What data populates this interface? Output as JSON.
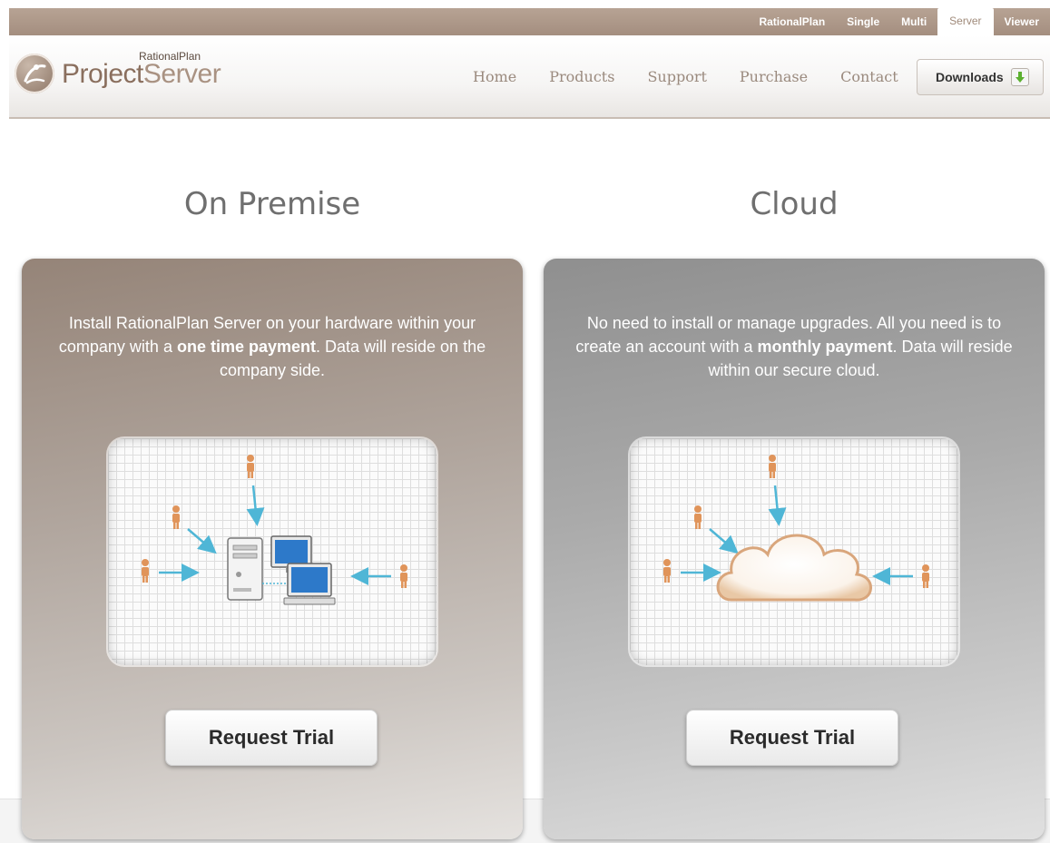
{
  "topbar": {
    "links": [
      {
        "label": "RationalPlan",
        "active": false
      },
      {
        "label": "Single",
        "active": false
      },
      {
        "label": "Multi",
        "active": false
      },
      {
        "label": "Server",
        "active": true
      },
      {
        "label": "Viewer",
        "active": false
      }
    ]
  },
  "header": {
    "logo_small": "RationalPlan",
    "logo_part1": "Project",
    "logo_part2": "Server",
    "nav": [
      "Home",
      "Products",
      "Support",
      "Purchase",
      "Contact"
    ],
    "downloads_label": "Downloads"
  },
  "on_premise": {
    "title": "On Premise",
    "desc_pre": "Install RationalPlan Server on your hardware within your company with a ",
    "desc_bold": "one time payment",
    "desc_post": ". Data will reside on the company side.",
    "button": "Request Trial"
  },
  "cloud": {
    "title": "Cloud",
    "desc_pre": "No need to install or manage upgrades. All you need is to create an account with a ",
    "desc_bold": "monthly payment",
    "desc_post": ". Data will reside within our secure cloud.",
    "button": "Request Trial"
  },
  "colors": {
    "brand_brown": "#a48e7f",
    "panel_left": "#958478",
    "panel_right": "#8f8f8f",
    "arrow_blue": "#4fb6d6",
    "person_orange": "#e0945a"
  }
}
